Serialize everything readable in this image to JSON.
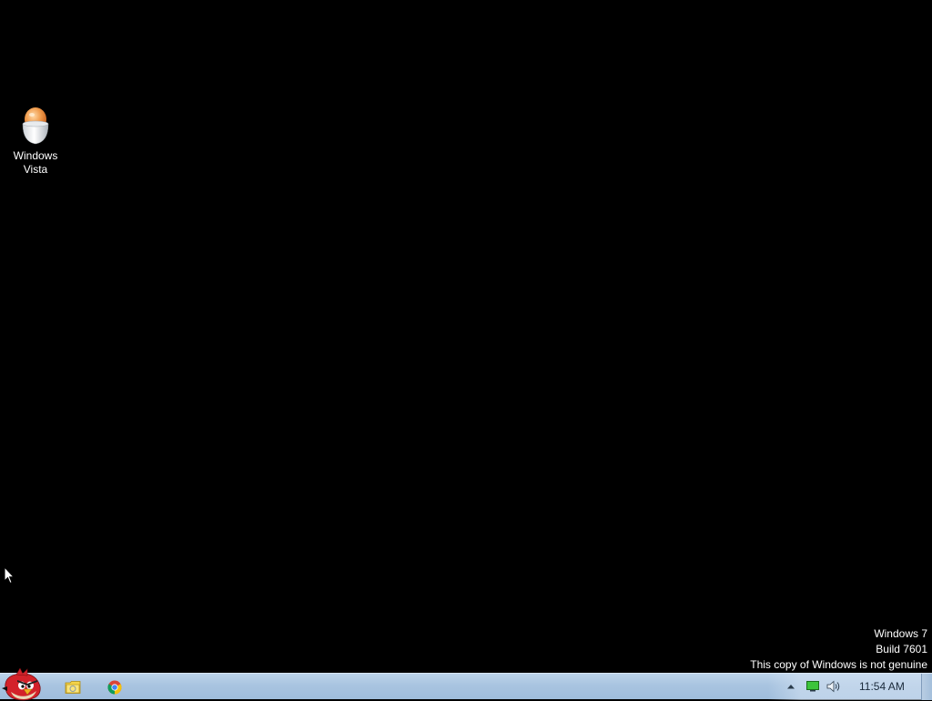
{
  "desktop": {
    "background_color": "#000000",
    "icons": [
      {
        "label": "Windows\nVista",
        "icon": "windows-vista-egg-icon"
      }
    ]
  },
  "watermark": {
    "line1": "Windows 7",
    "line2": "Build 7601",
    "line3": "This copy of Windows is not genuine"
  },
  "taskbar": {
    "background_color": "#a9c4e0",
    "start_icon": "angry-bird-start-icon",
    "pinned": [
      {
        "icon": "file-explorer-icon"
      },
      {
        "icon": "chrome-icon"
      }
    ],
    "tray": {
      "items": [
        {
          "icon": "show-hidden-icons-arrow-icon"
        },
        {
          "icon": "network-icon"
        },
        {
          "icon": "volume-icon"
        }
      ],
      "clock": "11:54 AM"
    }
  }
}
